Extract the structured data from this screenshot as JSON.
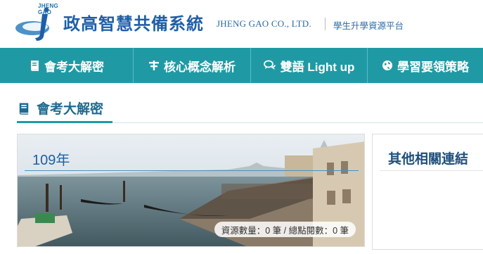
{
  "header": {
    "logo_text": "JHENG GAO",
    "title": "政高智慧共備系統",
    "company_en": "JHENG GAO CO., LTD.",
    "subtitle": "學生升學資源平台"
  },
  "nav": {
    "items": [
      {
        "label": "會考大解密",
        "icon": "book-icon"
      },
      {
        "label": "核心概念解析",
        "icon": "core-concept-icon"
      },
      {
        "label": "雙語 Light up",
        "icon": "chat-bubbles-icon"
      },
      {
        "label": "學習要領策略",
        "icon": "globe-icon"
      }
    ]
  },
  "section": {
    "title": "會考大解密",
    "icon": "book-icon"
  },
  "card": {
    "year": "109年",
    "stats": "資源數量：0 筆 / 總點閱數：0 筆"
  },
  "side": {
    "title": "其他相關連結"
  },
  "colors": {
    "nav_bg": "#1f9aa5",
    "brand_blue": "#1f5fa5",
    "accent_teal": "#1f9aa5"
  }
}
